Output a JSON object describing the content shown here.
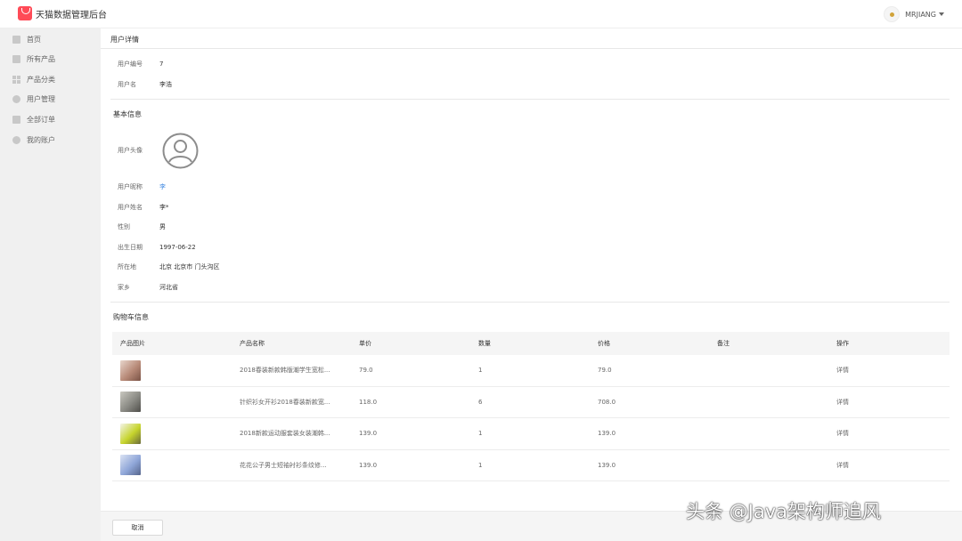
{
  "app": {
    "title": "天猫数据管理后台",
    "user": "MRJIANG"
  },
  "sidebar": {
    "items": [
      {
        "label": "首页",
        "icon": "home-icon"
      },
      {
        "label": "所有产品",
        "icon": "product-icon"
      },
      {
        "label": "产品分类",
        "icon": "grid-icon"
      },
      {
        "label": "用户管理",
        "icon": "user-icon"
      },
      {
        "label": "全部订单",
        "icon": "order-icon"
      },
      {
        "label": "我的账户",
        "icon": "gear-icon"
      }
    ]
  },
  "page": {
    "title": "用户详情"
  },
  "account": {
    "id_label": "用户编号",
    "id_value": "7",
    "name_label": "用户名",
    "name_value": "李浩"
  },
  "basic": {
    "section": "基本信息",
    "avatar_label": "用户头像",
    "nickname_label": "用户昵称",
    "nickname_value": "李",
    "realname_label": "用户姓名",
    "realname_value": "李*",
    "gender_label": "性别",
    "gender_value": "男",
    "birthday_label": "出生日期",
    "birthday_value": "1997-06-22",
    "address_label": "所在地",
    "address_value": "北京 北京市 门头沟区",
    "hometown_label": "家乡",
    "hometown_value": "河北省"
  },
  "cart": {
    "section": "购物车信息",
    "headers": [
      "产品图片",
      "产品名称",
      "单价",
      "数量",
      "价格",
      "备注",
      "操作"
    ],
    "rows": [
      {
        "name": "2018春装新款韩版潮学生宽松...",
        "price": "79.0",
        "qty": "1",
        "total": "79.0",
        "note": "",
        "action": "详情",
        "thumb_color": "#b88a78"
      },
      {
        "name": "针织衫女开衫2018春装新款宽...",
        "price": "118.0",
        "qty": "6",
        "total": "708.0",
        "note": "",
        "action": "详情",
        "thumb_color": "#8a8a84"
      },
      {
        "name": "2018新款运动服套装女装潮韩...",
        "price": "139.0",
        "qty": "1",
        "total": "139.0",
        "note": "",
        "action": "详情",
        "thumb_color": "#c6d42c"
      },
      {
        "name": "花花公子男士短袖衬衫条纹修...",
        "price": "139.0",
        "qty": "1",
        "total": "139.0",
        "note": "",
        "action": "详情",
        "thumb_color": "#8fa6d8"
      }
    ]
  },
  "footer": {
    "cancel_label": "取消"
  },
  "watermark": "头条 @Java架构师追风",
  "colors": {
    "brand": "#ff4b57",
    "link": "#4a8fe3",
    "action": "#f5575f"
  }
}
